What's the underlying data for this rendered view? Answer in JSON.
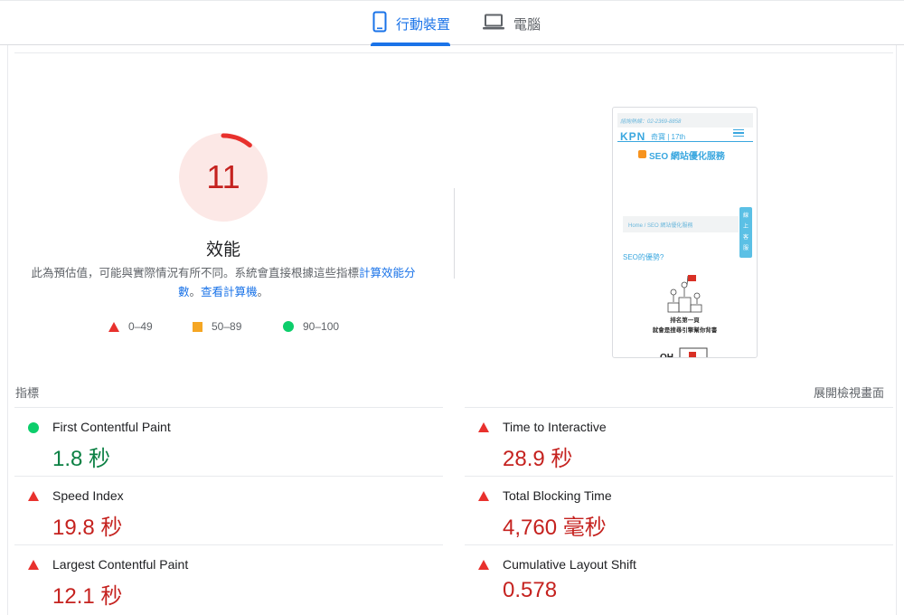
{
  "tabs": [
    {
      "label": "行動裝置",
      "icon": "phone-icon",
      "active": true
    },
    {
      "label": "電腦",
      "icon": "laptop-icon",
      "active": false
    }
  ],
  "performance": {
    "score": "11",
    "score_fraction": 0.11,
    "title": "效能",
    "desc_prefix": "此為預估值，可能與實際情況有所不同。系統會直接根據這些指標",
    "desc_link1": "計算效能分數",
    "desc_sep": "。",
    "desc_link2": "看計算機",
    "desc_link2_prefix": "查",
    "desc_end": "。",
    "colors": {
      "fail": "#e8312d",
      "average": "#f5a623",
      "pass": "#0cce6b",
      "fail_text": "#c5221f",
      "pass_text": "#0b8043",
      "accent": "#1a73e8"
    }
  },
  "legend": [
    {
      "icon": "triangle-icon",
      "label": "0–49"
    },
    {
      "icon": "square-icon",
      "label": "50–89"
    },
    {
      "icon": "circle-icon",
      "label": "90–100"
    }
  ],
  "preview": {
    "phone_line": "諮詢熱線：02-2369-8858",
    "logo": "KPN",
    "logo_sub": "奇寶 | 17th",
    "title": "SEO 網站優化服務",
    "breadcrumb": "Home  /  SEO 網站優化服務",
    "side_tab": "線上客服",
    "question": "SEO的優勢?",
    "caption1": "排名第一頁",
    "caption2": "就會是搜尋引擎幫你背書"
  },
  "metrics_section": {
    "label": "指標",
    "expand": "展開檢視畫面"
  },
  "metrics": [
    {
      "name": "First Contentful Paint",
      "value": "1.8 秒",
      "status": "pass"
    },
    {
      "name": "Time to Interactive",
      "value": "28.9 秒",
      "status": "fail"
    },
    {
      "name": "Speed Index",
      "value": "19.8 秒",
      "status": "fail"
    },
    {
      "name": "Total Blocking Time",
      "value": "4,760 毫秒",
      "status": "fail"
    },
    {
      "name": "Largest Contentful Paint",
      "value": "12.1 秒",
      "status": "fail"
    },
    {
      "name": "Cumulative Layout Shift",
      "value": "0.578",
      "status": "fail"
    }
  ]
}
